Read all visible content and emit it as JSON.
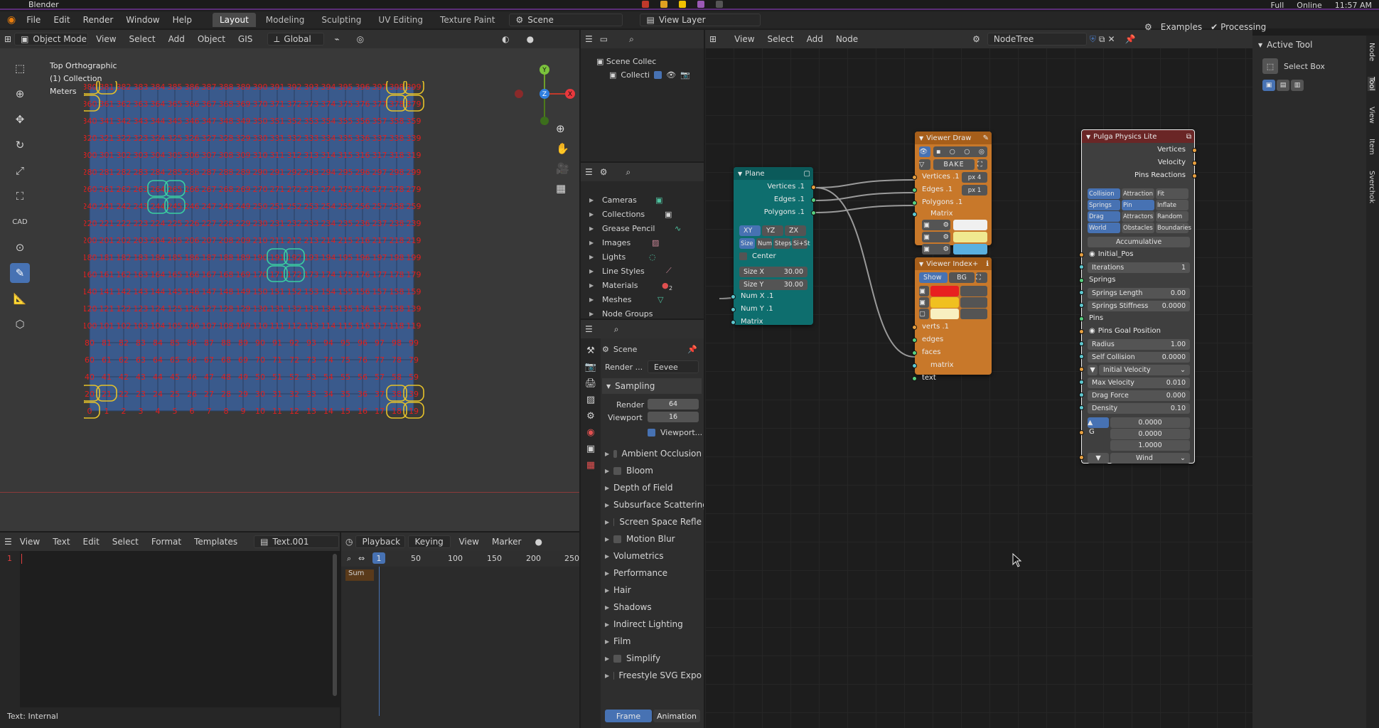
{
  "system_bar": {
    "app_name": "Blender",
    "fullscreen": "Full",
    "network": "Online",
    "clock": "11:57 AM"
  },
  "topbar": {
    "menus": [
      "File",
      "Edit",
      "Render",
      "Window",
      "Help"
    ],
    "workspaces": [
      "Layout",
      "Modeling",
      "Sculpting",
      "UV Editing",
      "Texture Paint"
    ],
    "active_workspace": "Layout",
    "scene": "Scene",
    "view_layer": "View Layer"
  },
  "viewport": {
    "mode": "Object Mode",
    "menus": [
      "View",
      "Select",
      "Add",
      "Object",
      "GIS"
    ],
    "orientation": "Global",
    "overlay_title": "Top Orthographic",
    "overlay_collection": "(1) Collection",
    "overlay_units": "Meters",
    "grid_cols": 20,
    "grid_rows": 20,
    "highlight_orange": [
      380,
      381,
      360,
      398,
      399,
      378,
      379,
      0,
      20,
      21,
      18,
      19,
      38,
      39
    ],
    "highlight_green": [
      264,
      265,
      244,
      245,
      191,
      192,
      171,
      172
    ],
    "gizmo": {
      "x": "X",
      "y": "Y",
      "z": "Z"
    }
  },
  "text_editor": {
    "menus": [
      "View",
      "Text",
      "Edit",
      "Select",
      "Format",
      "Templates"
    ],
    "file": "Text.001",
    "line_number": "1",
    "status": "Text: Internal"
  },
  "timeline": {
    "menus": [
      "Playback",
      "Keying",
      "View",
      "Marker"
    ],
    "current_frame": "1",
    "ticks": [
      "50",
      "100",
      "150",
      "200",
      "250"
    ],
    "summary_label": "Sum"
  },
  "outliner": {
    "scene_collection": "Scene Collec",
    "collection": "Collecti"
  },
  "data_api": {
    "items": [
      "Cameras",
      "Collections",
      "Grease Pencil",
      "Images",
      "Lights",
      "Line Styles",
      "Materials",
      "Meshes",
      "Node Groups"
    ],
    "materials_badge": "2"
  },
  "properties": {
    "scene_label": "Scene",
    "render_engine_label": "Render ...",
    "render_engine": "Eevee",
    "sampling": "Sampling",
    "render_label": "Render",
    "render_value": "64",
    "viewport_label": "Viewport",
    "viewport_value": "16",
    "viewport_denoise": "Viewport...",
    "panels": [
      {
        "label": "Ambient Occlusion",
        "checkbox": true
      },
      {
        "label": "Bloom",
        "checkbox": true
      },
      {
        "label": "Depth of Field",
        "checkbox": false
      },
      {
        "label": "Subsurface Scattering",
        "checkbox": false
      },
      {
        "label": "Screen Space Refle",
        "checkbox": true
      },
      {
        "label": "Motion Blur",
        "checkbox": true
      },
      {
        "label": "Volumetrics",
        "checkbox": false
      },
      {
        "label": "Performance",
        "checkbox": false
      },
      {
        "label": "Hair",
        "checkbox": false
      },
      {
        "label": "Shadows",
        "checkbox": false
      },
      {
        "label": "Indirect Lighting",
        "checkbox": false
      },
      {
        "label": "Film",
        "checkbox": false
      },
      {
        "label": "Simplify",
        "checkbox": true
      },
      {
        "label": "Freestyle SVG Expo",
        "checkbox": true
      }
    ],
    "tab_frame": "Frame",
    "tab_animation": "Animation"
  },
  "node_editor": {
    "menus": [
      "View",
      "Select",
      "Add",
      "Node"
    ],
    "tree_name": "NodeTree",
    "examples": "Examples",
    "processing": "Processing",
    "plane": {
      "title": "Plane",
      "outputs": [
        "Vertices .1",
        "Edges .1",
        "Polygons .1"
      ],
      "axes": [
        "XY",
        "YZ",
        "ZX"
      ],
      "modes": [
        "Size",
        "Num",
        "Steps",
        "Si+St"
      ],
      "center": "Center",
      "size_x_label": "Size X",
      "size_x": "30.00",
      "size_y_label": "Size Y",
      "size_y": "30.00",
      "inputs": [
        "Num X .1",
        "Num Y .1",
        "Matrix"
      ]
    },
    "viewer_draw": {
      "title": "Viewer Draw",
      "bake": "BAKE",
      "inputs": [
        "Vertices .1",
        "Edges .1",
        "Polygons .1",
        "Matrix"
      ],
      "px_vert": "px  4",
      "px_edge": "px  1"
    },
    "viewer_index": {
      "title": "Viewer Index+",
      "show": "Show",
      "bg": "BG",
      "inputs": [
        "verts .1",
        "edges",
        "faces",
        "matrix",
        "text"
      ]
    },
    "pulga": {
      "title": "Pulga Physics Lite",
      "outputs": [
        "Vertices",
        "Velocity",
        "Pins Reactions"
      ],
      "toggles": [
        [
          "Collision",
          "Attraction",
          "Fit"
        ],
        [
          "Springs",
          "Pin",
          "Inflate"
        ],
        [
          "Drag",
          "Attractors",
          "Random"
        ],
        [
          "World",
          "Obstacles",
          "Boundaries"
        ]
      ],
      "accumulative": "Accumulative",
      "initial_pos": "Initial_Pos",
      "iterations_label": "Iterations",
      "iterations": "1",
      "springs": "Springs",
      "springs_length_label": "Springs Length",
      "springs_length": "0.00",
      "springs_stiffness_label": "Springs Stiffness",
      "springs_stiffness": "0.0000",
      "pins": "Pins",
      "pins_goal": "Pins Goal Position",
      "radius_label": "Radius",
      "radius": "1.00",
      "self_collision_label": "Self Collision",
      "self_collision": "0.0000",
      "initial_velocity": "Initial Velocity",
      "max_velocity_label": "Max Velocity",
      "max_velocity": "0.010",
      "drag_force_label": "Drag Force",
      "drag_force": "0.000",
      "density_label": "Density",
      "density": "0.10",
      "vec_a": "0.0000",
      "vec_b": "0.0000",
      "vec_c": "1.0000",
      "g_label": "G",
      "wind": "Wind"
    }
  },
  "sidebar": {
    "active_tool": "Active Tool",
    "select_box": "Select Box",
    "tabs": [
      "Node",
      "Tool",
      "View",
      "Item",
      "Sverchok"
    ]
  },
  "colors": {
    "accent": "#4772b3",
    "plane_node": "#0e6e6e",
    "viewer_node": "#c8782a",
    "pulga_node": "#3f3f3f",
    "orange_sel": "#e6c229",
    "green_sel": "#3ad0a0",
    "grid_face": "#3a5a8c",
    "index_text": "#e02020"
  }
}
